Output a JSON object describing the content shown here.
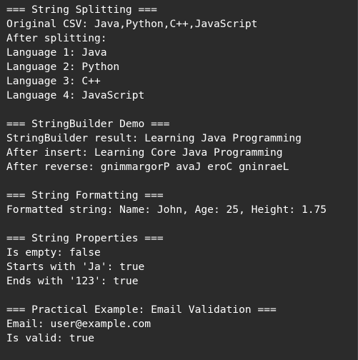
{
  "console": {
    "colors": {
      "background": "#2b2b2b",
      "text": "#ffffff"
    },
    "lines": {
      "l1": "=== String Splitting ===",
      "l2": "Original CSV: Java,Python,C++,JavaScript",
      "l3": "After splitting:",
      "l4": "Language 1: Java",
      "l5": "Language 2: Python",
      "l6": "Language 3: C++",
      "l7": "Language 4: JavaScript",
      "l8": "=== StringBuilder Demo ===",
      "l9": "StringBuilder result: Learning Java Programming",
      "l10": "After insert: Learning Core Java Programming",
      "l11": "After reverse: gnimmargorP avaJ eroC gninraeL",
      "l12": "=== String Formatting ===",
      "l13": "Formatted string: Name: John, Age: 25, Height: 1.75",
      "l14": "=== String Properties ===",
      "l15": "Is empty: false",
      "l16": "Starts with 'Ja': true",
      "l17": "Ends with '123': true",
      "l18": "=== Practical Example: Email Validation ===",
      "l19": "Email: user@example.com",
      "l20": "Is valid: true"
    }
  }
}
